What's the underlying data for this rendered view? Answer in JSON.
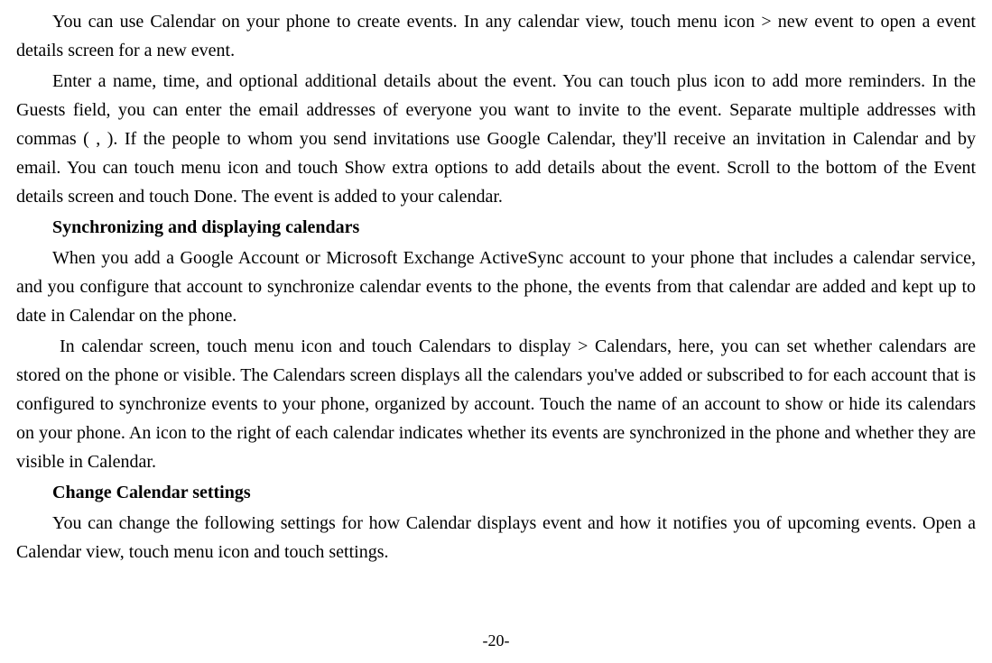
{
  "paragraphs": {
    "p1": "You can use Calendar on your phone to create events. In any calendar view, touch menu icon > new event to open a event details screen for a new event.",
    "p2": "Enter a name, time, and optional additional details about the event. You can touch plus icon to add more reminders. In the Guests field, you can enter the email addresses of everyone you want to invite to the event. Separate multiple addresses with commas ( , ). If the people to whom you send invitations use Google Calendar, they'll receive an invitation in Calendar and by email. You can touch menu icon and touch Show extra options to add details about the event. Scroll to the bottom of the Event details screen and touch Done. The event is added to your calendar.",
    "h1": "Synchronizing and displaying calendars",
    "p3": "When you add a Google Account or Microsoft Exchange ActiveSync account to your phone that includes a calendar service, and you configure that account to synchronize calendar events to the phone, the events from that calendar are added and kept up to date in Calendar on the phone.",
    "p4": "In calendar screen, touch menu icon and touch Calendars to display > Calendars, here, you can set whether calendars are stored on the phone or visible. The Calendars screen displays all the calendars you've added or subscribed to for each account that is configured to synchronize events to your phone, organized by account. Touch the name of an account to show or hide its calendars on your phone. An icon to the right of each calendar indicates whether its events are synchronized in the phone and whether they are visible in Calendar.",
    "h2": "Change Calendar settings",
    "p5": "You can change the following settings for how Calendar displays event and how it notifies you of upcoming events. Open a Calendar view, touch menu icon and touch settings."
  },
  "pageNumber": "-20-"
}
